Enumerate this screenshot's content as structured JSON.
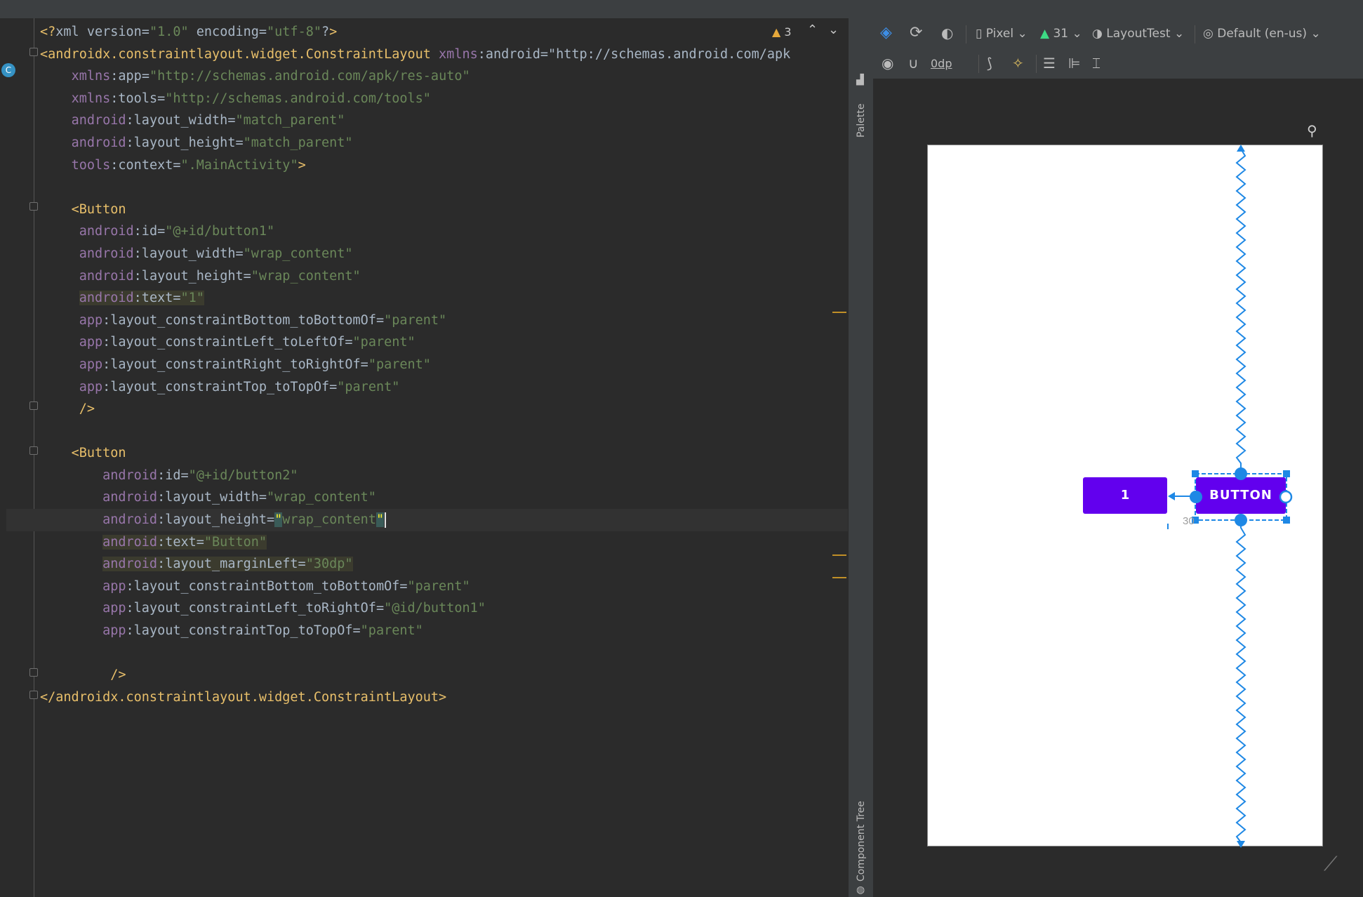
{
  "editor": {
    "warnings_count": "3",
    "lines": [
      "<?xml version=\"1.0\" encoding=\"utf-8\"?>",
      "<androidx.constraintlayout.widget.ConstraintLayout xmlns:android=\"http://schemas.android.com/apk",
      "    xmlns:app=\"http://schemas.android.com/apk/res-auto\"",
      "    xmlns:tools=\"http://schemas.android.com/tools\"",
      "    android:layout_width=\"match_parent\"",
      "    android:layout_height=\"match_parent\"",
      "    tools:context=\".MainActivity\">",
      "",
      "    <Button",
      "     android:id=\"@+id/button1\"",
      "     android:layout_width=\"wrap_content\"",
      "     android:layout_height=\"wrap_content\"",
      "     android:text=\"1\"",
      "     app:layout_constraintBottom_toBottomOf=\"parent\"",
      "     app:layout_constraintLeft_toLeftOf=\"parent\"",
      "     app:layout_constraintRight_toRightOf=\"parent\"",
      "     app:layout_constraintTop_toTopOf=\"parent\"",
      "     />",
      "",
      "    <Button",
      "        android:id=\"@+id/button2\"",
      "        android:layout_width=\"wrap_content\"",
      "        android:layout_height=\"wrap_content\"",
      "        android:text=\"Button\"",
      "        android:layout_marginLeft=\"30dp\"",
      "        app:layout_constraintBottom_toBottomOf=\"parent\"",
      "        app:layout_constraintLeft_toRightOf=\"@id/button1\"",
      "        app:layout_constraintTop_toTopOf=\"parent\"",
      "",
      "         />",
      "</androidx.constraintlayout.widget.ConstraintLayout>"
    ]
  },
  "side_strip": {
    "palette_label": "Palette",
    "component_tree_label": "Component Tree"
  },
  "design_toolbar": {
    "device": "Pixel",
    "api_level": "31",
    "theme": "LayoutTest",
    "locale": "Default (en-us)",
    "margin_value": "0dp"
  },
  "preview": {
    "button1_label": "1",
    "button2_label": "BUTTON",
    "margin_label": "30"
  },
  "colors": {
    "button_purple": "#6200ee",
    "constraint_blue": "#1e88e5",
    "tag_yellow": "#e8bf6a",
    "string_green": "#6a8759",
    "namespace_purple": "#9876aa"
  }
}
